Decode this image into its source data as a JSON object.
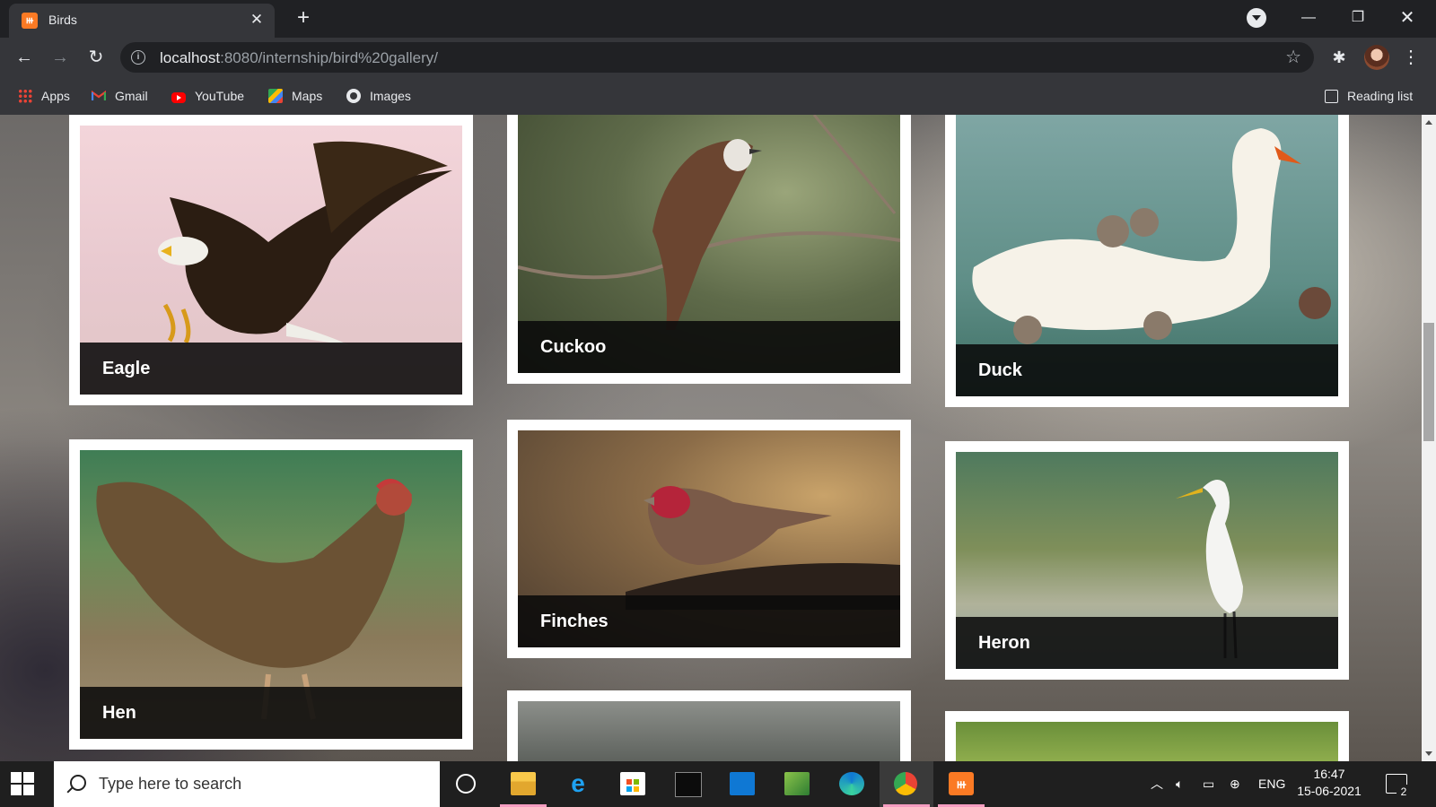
{
  "browser": {
    "tab": {
      "title": "Birds",
      "favicon": "xampp-icon"
    },
    "url": {
      "host": "localhost",
      "path": ":8080/internship/bird%20gallery/"
    },
    "bookmarks": [
      "Apps",
      "Gmail",
      "YouTube",
      "Maps",
      "Images"
    ],
    "reading_list": "Reading list"
  },
  "gallery": {
    "cards": [
      {
        "label": "Eagle"
      },
      {
        "label": "Cuckoo"
      },
      {
        "label": "Duck"
      },
      {
        "label": "Hen"
      },
      {
        "label": "Finches"
      },
      {
        "label": "Heron"
      }
    ]
  },
  "taskbar": {
    "search_placeholder": "Type here to search",
    "language": "ENG",
    "time": "16:47",
    "date": "15-06-2021",
    "notification_count": "2"
  }
}
